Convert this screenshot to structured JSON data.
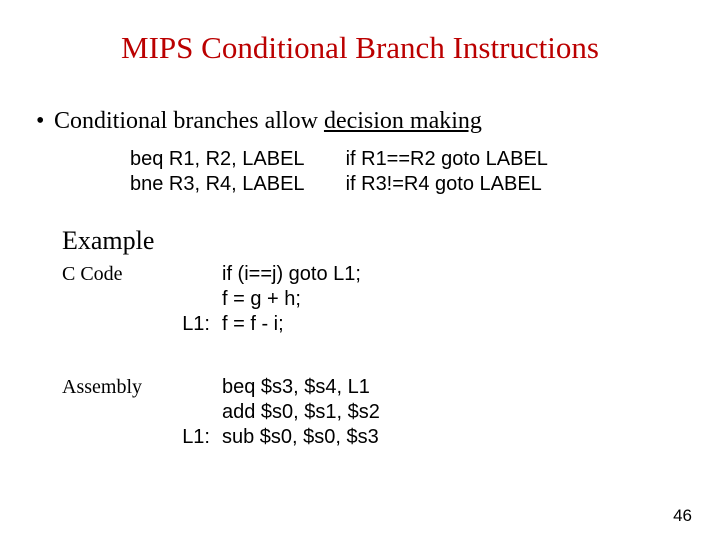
{
  "title": "MIPS Conditional Branch Instructions",
  "bullet_prefix": "Conditional branches allow ",
  "bullet_underlined": "decision making",
  "instr": {
    "row1": {
      "asm": "beq R1, R2, LABEL",
      "meaning": "if R1==R2 goto LABEL"
    },
    "row2": {
      "asm": "bne R3, R4, LABEL",
      "meaning": "if R3!=R4 goto LABEL"
    }
  },
  "example_heading": "Example",
  "ccode": {
    "label": "C Code",
    "l1": "if (i==j) goto L1;",
    "l2": "f = g + h;",
    "tag": "L1:",
    "l3": "f = f - i;"
  },
  "asm": {
    "label": "Assembly",
    "l1": "beq $s3, $s4, L1",
    "l2": "add $s0, $s1, $s2",
    "tag": "L1:",
    "l3": "sub $s0, $s0, $s3"
  },
  "page_number": "46"
}
